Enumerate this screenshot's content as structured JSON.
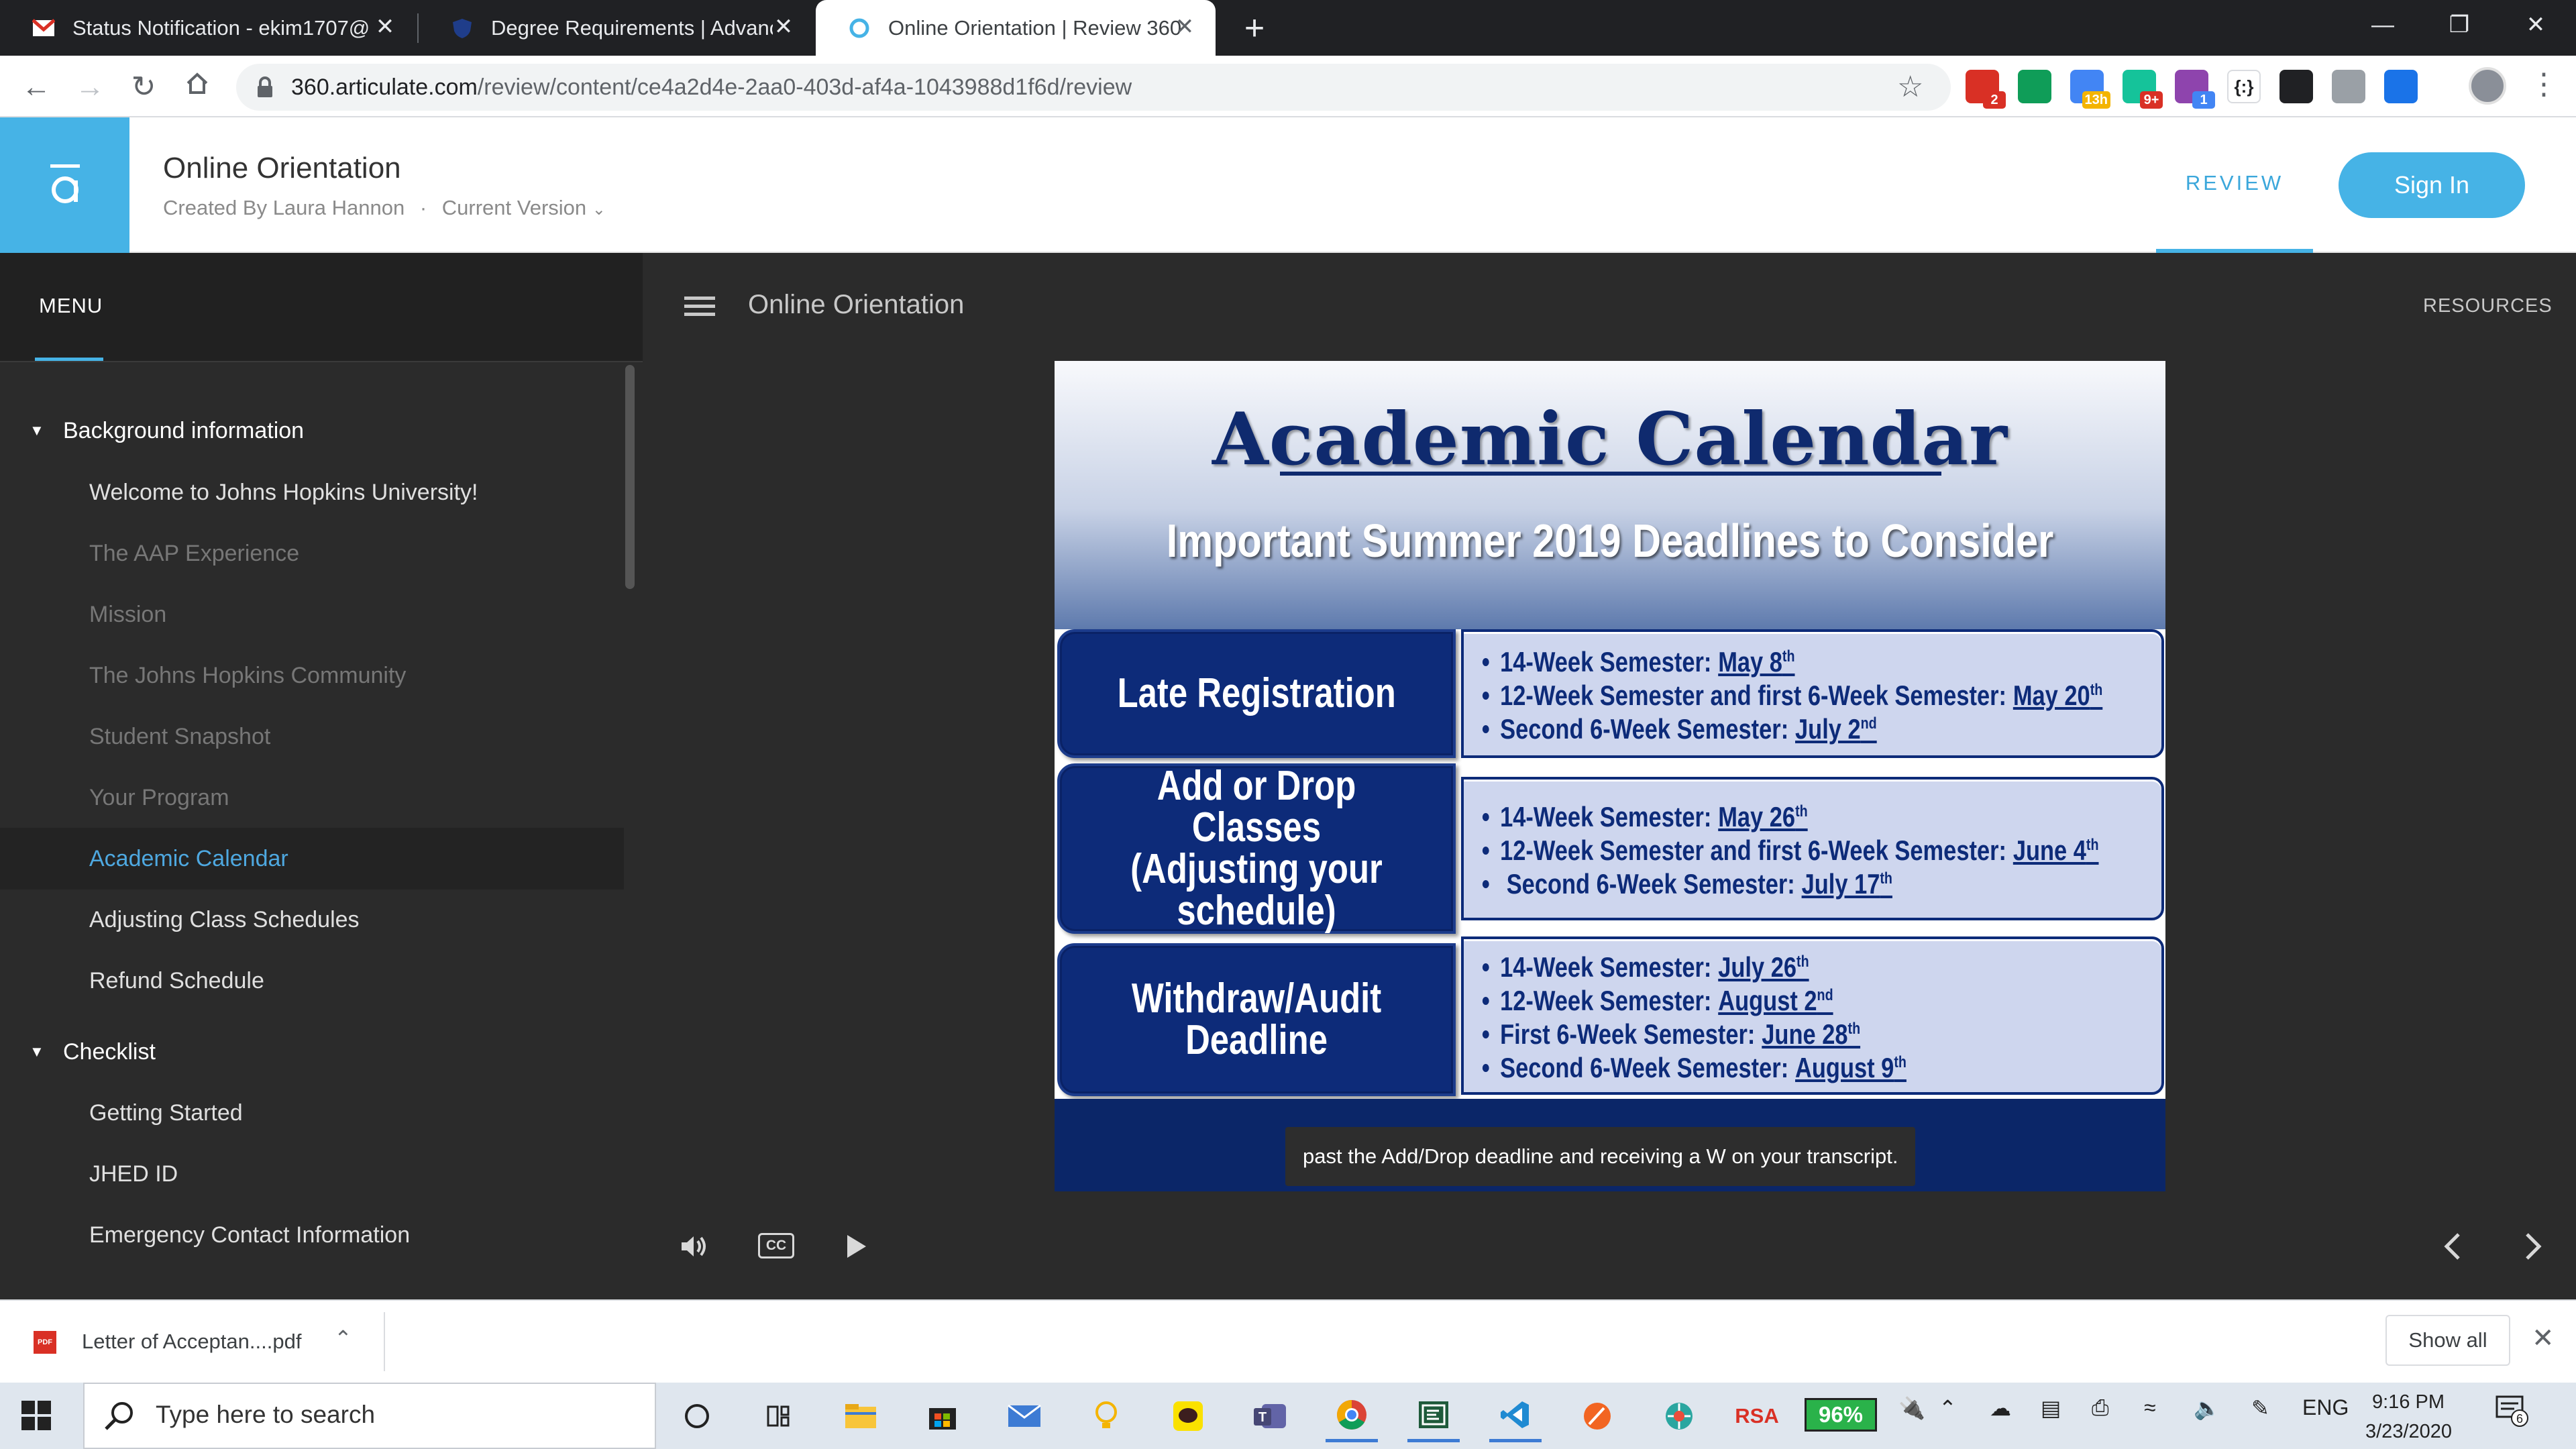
{
  "browser": {
    "tabs": [
      {
        "label": "Status Notification - ekim1707@",
        "icon": "gmail-icon"
      },
      {
        "label": "Degree Requirements | Advanced",
        "icon": "shield-icon"
      },
      {
        "label": "Online Orientation | Review 360",
        "icon": "articulate-icon"
      }
    ],
    "close_glyph": "✕",
    "new_tab_glyph": "+",
    "url_domain": "360.articulate.com",
    "url_path": "/review/content/ce4a2d4e-2aa0-403d-af4a-1043988d1f6d/review",
    "extensions": [
      {
        "name": "gmail-ext-icon",
        "label": "M",
        "badge": "2",
        "color": "#d93025",
        "badge_color": "#d93025"
      },
      {
        "name": "hangouts-ext-icon",
        "label": "",
        "badge": "",
        "color": "#0f9d58",
        "badge_color": ""
      },
      {
        "name": "calendar-ext-icon",
        "label": "",
        "badge": "13h",
        "color": "#4285f4",
        "badge_color": "#f4b400"
      },
      {
        "name": "grammarly-ext-icon",
        "label": "G",
        "badge": "9+",
        "color": "#15c39a",
        "badge_color": "#d93025"
      },
      {
        "name": "p-ext-icon",
        "label": "P",
        "badge": "1",
        "color": "#8e44ad",
        "badge_color": "#4285f4"
      },
      {
        "name": "regex-ext-icon",
        "label": "{:}",
        "badge": "",
        "color": "#ffffff",
        "badge_color": ""
      },
      {
        "name": "qr-ext-icon",
        "label": "",
        "badge": "",
        "color": "#202124",
        "badge_color": ""
      },
      {
        "name": "circle-ext-icon",
        "label": "",
        "badge": "",
        "color": "#9aa0a6",
        "badge_color": ""
      },
      {
        "name": "shield-ext-icon",
        "label": "",
        "badge": "",
        "color": "#1a73e8",
        "badge_color": ""
      }
    ]
  },
  "app": {
    "title": "Online Orientation",
    "created_by": "Created By Laura Hannon",
    "separator": "·",
    "version": "Current Version",
    "review_tab": "REVIEW",
    "signin": "Sign In",
    "accent": "#46b3e6"
  },
  "sidebar": {
    "menu_label": "MENU",
    "sections": [
      {
        "label": "Background information"
      },
      {
        "label": "Checklist"
      }
    ],
    "items": [
      {
        "label": "Welcome to Johns Hopkins University!",
        "state": "visited"
      },
      {
        "label": "The AAP Experience",
        "state": "dim"
      },
      {
        "label": "Mission",
        "state": "dim"
      },
      {
        "label": "The Johns Hopkins Community",
        "state": "dim"
      },
      {
        "label": "Student Snapshot",
        "state": "dim"
      },
      {
        "label": "Your Program",
        "state": "dim"
      },
      {
        "label": "Academic Calendar",
        "state": "current"
      },
      {
        "label": "Adjusting Class Schedules",
        "state": "visited"
      },
      {
        "label": "Refund Schedule",
        "state": "visited"
      },
      {
        "label": "Getting Started",
        "state": "visited"
      },
      {
        "label": "JHED ID",
        "state": "visited"
      },
      {
        "label": "Emergency Contact Information",
        "state": "visited"
      }
    ]
  },
  "player": {
    "title": "Online Orientation",
    "resources": "RESOURCES",
    "cc_label": "CC",
    "caption": "past the Add/Drop deadline and receiving a W on your transcript."
  },
  "slide": {
    "title": "Academic Calendar",
    "subtitle": "Important Summer 2019 Deadlines to Consider",
    "rows": [
      {
        "label": "Late Registration",
        "dates": [
          {
            "text": "14-Week Semester:",
            "date": "May 8",
            "sup": "th"
          },
          {
            "text": "12-Week Semester and first 6-Week Semester:",
            "date": "May 20",
            "sup": "th"
          },
          {
            "text": "Second 6-Week Semester:",
            "date": "July 2",
            "sup": "nd"
          }
        ]
      },
      {
        "label": "Add or Drop Classes\n(Adjusting your\nschedule)",
        "dates": [
          {
            "text": "14-Week Semester:",
            "date": "May 26",
            "sup": "th"
          },
          {
            "text": "12-Week Semester and first 6-Week Semester:",
            "date": "June 4",
            "sup": "th"
          },
          {
            "text": " Second 6-Week Semester:",
            "date": "July 17",
            "sup": "th"
          }
        ]
      },
      {
        "label": "Withdraw/Audit\nDeadline",
        "dates": [
          {
            "text": "14-Week Semester:",
            "date": "July 26",
            "sup": "th"
          },
          {
            "text": "12-Week Semester:",
            "date": "August 2",
            "sup": "nd"
          },
          {
            "text": "First 6-Week Semester:",
            "date": "June 28",
            "sup": "th"
          },
          {
            "text": "Second 6-Week Semester:",
            "date": "August 9",
            "sup": "th"
          }
        ]
      }
    ]
  },
  "downloads": {
    "file": "Letter of Acceptan....pdf",
    "pdf_tag": "PDF",
    "show_all": "Show all"
  },
  "taskbar": {
    "search_placeholder": "Type here to search",
    "rsa": "RSA",
    "battery": "96%",
    "language": "ENG",
    "time": "9:16 PM",
    "date": "3/23/2020",
    "notifications": "6"
  }
}
